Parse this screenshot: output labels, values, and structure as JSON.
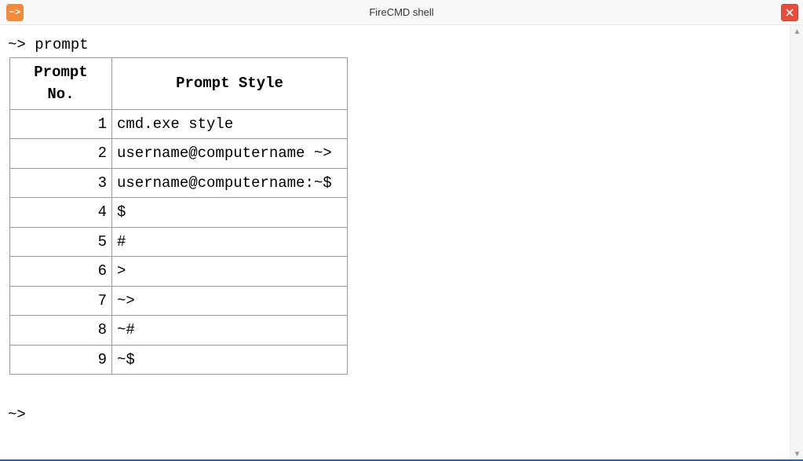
{
  "window": {
    "title": "FireCMD shell",
    "app_icon_text": "~>"
  },
  "terminal": {
    "command_line": "~> prompt",
    "prompt_after": "~>",
    "table": {
      "headers": {
        "col1": "Prompt No.",
        "col2": "Prompt Style"
      },
      "rows": [
        {
          "no": "1",
          "style": "cmd.exe style"
        },
        {
          "no": "2",
          "style": "username@computername ~>"
        },
        {
          "no": "3",
          "style": "username@computername:~$"
        },
        {
          "no": "4",
          "style": "$"
        },
        {
          "no": "5",
          "style": "#"
        },
        {
          "no": "6",
          "style": ">"
        },
        {
          "no": "7",
          "style": "~>"
        },
        {
          "no": "8",
          "style": "~#"
        },
        {
          "no": "9",
          "style": "~$"
        }
      ]
    }
  }
}
